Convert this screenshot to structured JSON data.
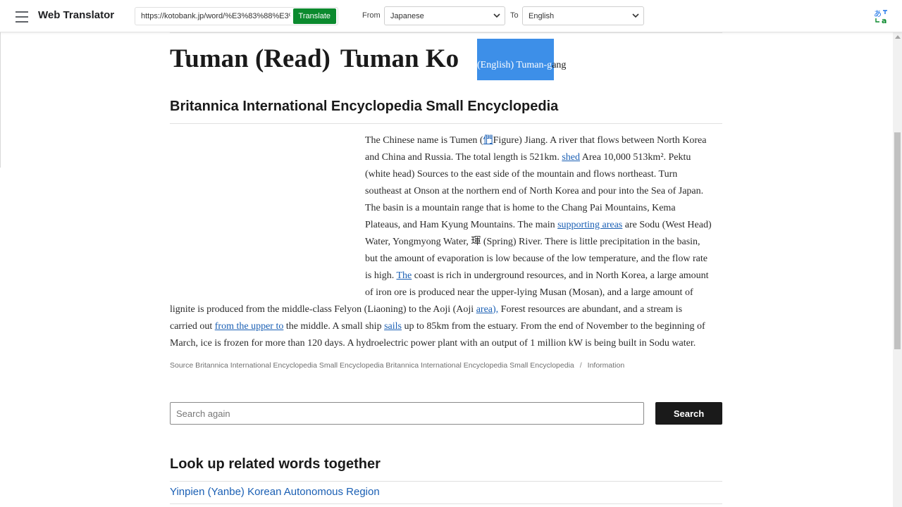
{
  "toolbar": {
    "app_title": "Web Translator",
    "url_value": "https://kotobank.jp/word/%E3%83%88%E3%83%A5%E3%83%9E%E3%83%B3%E6%B1%9F",
    "translate_label": "Translate",
    "from_label": "From",
    "from_value": "Japanese",
    "to_label": "To",
    "to_value": "English",
    "icons": [
      "menu-icon",
      "chevron-down-icon",
      "translate-icon"
    ],
    "accent_color": "#0b8a2e"
  },
  "article": {
    "headline_a": "Tuman (Read)",
    "headline_b": "Tuman Ko",
    "english_hl": "(English) Tuman-g",
    "english_rest": "ang",
    "section_title": "Britannica International Encyclopedia Small Encyclopedia",
    "lines_narrow": [
      {
        "t1": "The Chinese name is Tumen (",
        "link": "們",
        "t2": "Figure) Jiang. A river that flows between North Korea"
      },
      {
        "t1": "and China and Russia. The total length is 521km. ",
        "link": "shed",
        "t2": " Area 10,000 513km². Pektu"
      },
      {
        "t1": "(white head) Sources to the east side of the mountain and flows northeast. Turn",
        "link": "",
        "t2": ""
      },
      {
        "t1": "southeast at Onson at the northern end of North Korea and pour into the Sea of Japan.",
        "link": "",
        "t2": ""
      },
      {
        "t1": "The basin is a mountain range that is home to the Chang Pai Mountains, Kema",
        "link": "",
        "t2": ""
      },
      {
        "t1": "Plateaus, and Ham Kyung Mountains. The main ",
        "link": "supporting areas",
        "t2": " are Sodu (West Head)"
      },
      {
        "t1": "Water, Yongmyong Water, 琿 (Spring) River. There is little precipitation in the basin,",
        "link": "",
        "t2": ""
      },
      {
        "t1": "but the amount of evaporation is low because of the low temperature, and the flow rate",
        "link": "",
        "t2": ""
      },
      {
        "t1": "is high. ",
        "link": "The",
        "t2": " coast is rich in underground resources, and in North Korea, a large amount"
      },
      {
        "t1": "of iron ore is produced near the upper-lying Musan (Mosan), and a large amount of",
        "link": "",
        "t2": ""
      }
    ],
    "lines_wide": [
      {
        "t1": "lignite is produced from the middle-class Felyon (Liaoning) to the Aoji (Aoji ",
        "link": "area),",
        "t2": " Forest resources are abundant, and a stream is"
      },
      {
        "t1": "carried out ",
        "link": "from the upper to",
        "t2": " the middle. A small ship "
      },
      {
        "t1": "March, ice is frozen for more than 120 days. A hydroelectric power plant with an output of 1 million kW is being built in Sodu water.",
        "link": "",
        "t2": ""
      }
    ],
    "wide_line2_link2": "sails",
    "wide_line2_tail": " up to 85km from the estuary. From the end of November to the beginning of",
    "source": "Source Britannica International Encyclopedia Small Encyclopedia Britannica International Encyclopedia Small Encyclopedia",
    "source_sep": "/",
    "source_info": "Information"
  },
  "search": {
    "placeholder": "Search again",
    "button_label": "Search"
  },
  "related": {
    "title": "Look up related words together",
    "items": [
      "Yinpien (Yanbe) Korean Autonomous Region"
    ]
  },
  "colors": {
    "link": "#1a5fb4",
    "highlight": "#3d8fe8"
  }
}
